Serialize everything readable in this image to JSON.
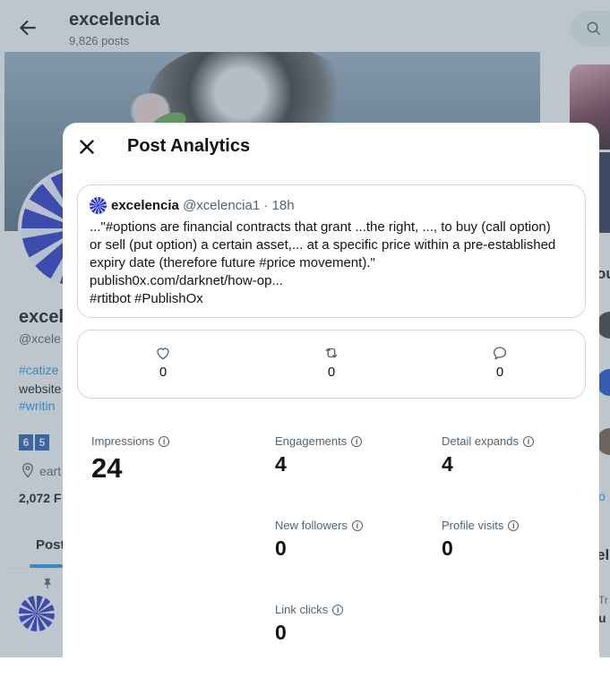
{
  "profile_header": {
    "title": "excelencia",
    "posts_count": "9,826 posts"
  },
  "profile": {
    "name": "excel",
    "handle": "@xcele",
    "bio_tag1": "#catize",
    "bio_line2": "website",
    "bio_tag2": "#writin",
    "badges": [
      "6",
      "5"
    ],
    "location": "eart",
    "followers": "2,072 F",
    "tab_posts": "Post"
  },
  "right_column": {
    "partial_text1": "ou",
    "partial_text2": "el",
    "partial_text3": "Tr",
    "partial_text4": "u",
    "partial_link": "o"
  },
  "modal": {
    "title": "Post Analytics",
    "post": {
      "author": "excelencia",
      "handle": "@xcelencia1",
      "dot": "·",
      "time": "18h",
      "lines": [
        "...\"#options are financial contracts that grant ...the right, ..., to buy (call option)",
        "or sell (put option) a certain asset,... at a specific price within a pre-established",
        "expiry date (therefore future #price movement).\"",
        "publish0x.com/darknet/how-op...",
        "#rtitbot #PublishOx"
      ]
    },
    "counts": {
      "likes": "0",
      "reposts": "0",
      "replies": "0"
    },
    "metrics": {
      "impressions": {
        "label": "Impressions",
        "value": "24"
      },
      "engagements": {
        "label": "Engagements",
        "value": "4"
      },
      "detail_expands": {
        "label": "Detail expands",
        "value": "4"
      },
      "new_followers": {
        "label": "New followers",
        "value": "0"
      },
      "profile_visits": {
        "label": "Profile visits",
        "value": "0"
      },
      "link_clicks": {
        "label": "Link clicks",
        "value": "0"
      }
    },
    "info_glyph": "i"
  }
}
